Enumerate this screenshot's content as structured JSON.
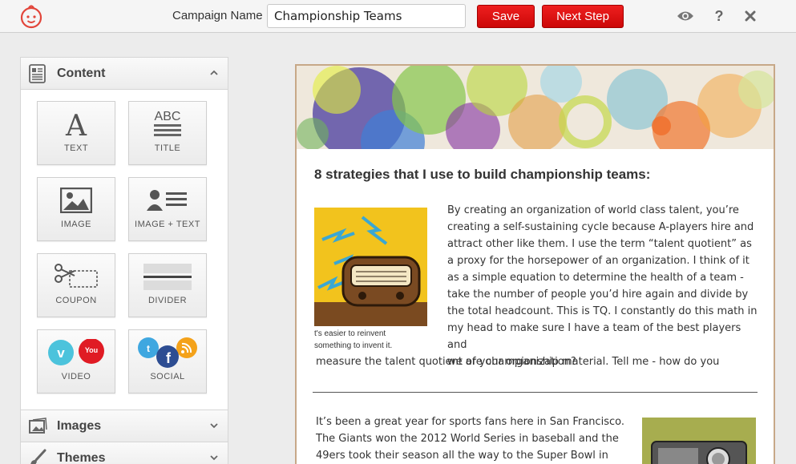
{
  "header": {
    "campaign_label": "Campaign Name",
    "campaign_value": "Championship Teams",
    "save_label": "Save",
    "next_label": "Next Step",
    "icons": [
      "logo-icon",
      "eye-icon",
      "help-icon",
      "close-icon"
    ]
  },
  "sidebar": {
    "content_panel": {
      "title": "Content",
      "tiles": [
        {
          "label": "TEXT",
          "icon": "text-icon"
        },
        {
          "label": "TITLE",
          "icon": "title-icon",
          "icon_text": "ABC"
        },
        {
          "label": "IMAGE",
          "icon": "image-icon"
        },
        {
          "label": "IMAGE + TEXT",
          "icon": "image-text-icon"
        },
        {
          "label": "COUPON",
          "icon": "coupon-icon"
        },
        {
          "label": "DIVIDER",
          "icon": "divider-icon"
        },
        {
          "label": "VIDEO",
          "icon": "video-icon",
          "icon_text": "You"
        },
        {
          "label": "SOCIAL",
          "icon": "social-icon"
        }
      ]
    },
    "images_panel": {
      "title": "Images"
    },
    "themes_panel": {
      "title": "Themes"
    }
  },
  "email": {
    "title": "8 strategies that I use to build championship teams:",
    "caption_lines": [
      "t's easier to reinvent",
      "something to invent it."
    ],
    "paragraph1_lines": [
      "By creating an organization of world class talent, you’re",
      "creating a self-sustaining cycle because A-players hire and",
      "attract other like them. I use the term “talent quotient” as",
      "a proxy for the horsepower of an organization. I think of it",
      "as a simple equation to determine the health of a team -",
      "take the number of people you’d hire again and divide by",
      "the total headcount. This is TQ. I constantly do this math in",
      "my head to make sure I have a team of the best players and",
      "we are championship material. Tell me - how do you"
    ],
    "paragraph1_last": "measure the talent quotient of your organization?",
    "paragraph2_lines": [
      "It’s been a great year for sports fans here in San Francisco.",
      "The Giants won the 2012 World Series in baseball and the",
      "49ers took their season all the way to the Super Bowl in"
    ]
  },
  "colors": {
    "accent": "#dd1111",
    "canvas_border": "#c7a888"
  }
}
